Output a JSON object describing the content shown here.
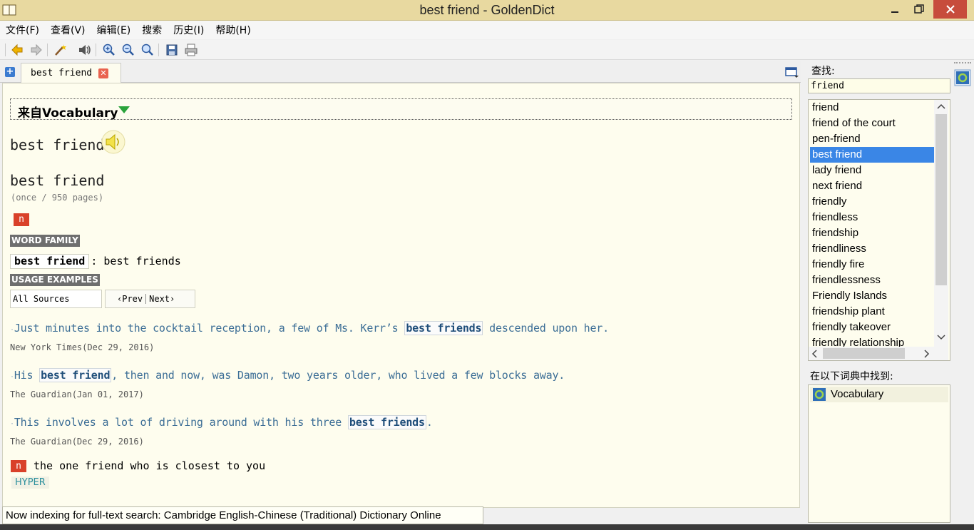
{
  "window": {
    "title": "best friend - GoldenDict",
    "accent_color": "#e8d9a0",
    "close_color": "#c74c3c"
  },
  "menubar": {
    "items": [
      "文件(F)",
      "查看(V)",
      "编辑(E)",
      "搜索",
      "历史(I)",
      "帮助(H)"
    ]
  },
  "toolbar": {
    "icons": [
      "back-icon",
      "forward-icon",
      "scan-popup-icon",
      "pronounce-icon",
      "zoom-in-icon",
      "zoom-out-icon",
      "zoom-reset-icon",
      "save-icon",
      "print-icon"
    ]
  },
  "tabs": [
    {
      "label": "best friend",
      "active": true
    }
  ],
  "article": {
    "dict_header": "来自Vocabulary",
    "headword": "best friend",
    "headword2": "best friend",
    "frequency": "(once / 950 pages)",
    "pos1": "n",
    "word_family_label": "WORD FAMILY",
    "word_family_word": "best friend",
    "word_family_forms": ": best friends",
    "usage_label": "USAGE EXAMPLES",
    "source_select": "All Sources",
    "prev_label": "‹Prev",
    "next_label": "Next›",
    "examples": [
      {
        "pre": "Just minutes into the cocktail reception, a few of Ms. Kerr’s ",
        "highlight": "best friends",
        "post": " descended upon her.",
        "source": "New York Times(Dec 29, 2016)"
      },
      {
        "pre": "His ",
        "highlight": "best friend",
        "post": ", then and now, was Damon, two years older, who lived a few blocks away.",
        "source": "The Guardian(Jan 01, 2017)"
      },
      {
        "pre": "This involves a lot of driving around with his three ",
        "highlight": "best friends",
        "post": ".",
        "source": "The Guardian(Dec 29, 2016)"
      }
    ],
    "pos2": "n",
    "definition": "the one friend who is closest to you",
    "hyper": "HYPER"
  },
  "status": {
    "text": "Now indexing for full-text search: Cambridge English-Chinese (Traditional) Dictionary Online"
  },
  "search": {
    "label": "查找:",
    "value": "friend"
  },
  "word_list": {
    "items": [
      "friend",
      "friend of the court",
      "pen-friend",
      "best friend",
      "lady friend",
      "next friend",
      "friendly",
      "friendless",
      "friendship",
      "friendliness",
      "friendly fire",
      "friendlessness",
      "Friendly Islands",
      "friendship plant",
      "friendly takeover",
      "friendly relationship"
    ],
    "selected": "best friend",
    "selection_color": "#3a86e6"
  },
  "found_in": {
    "label": "在以下词典中找到:",
    "items": [
      "Vocabulary"
    ]
  }
}
